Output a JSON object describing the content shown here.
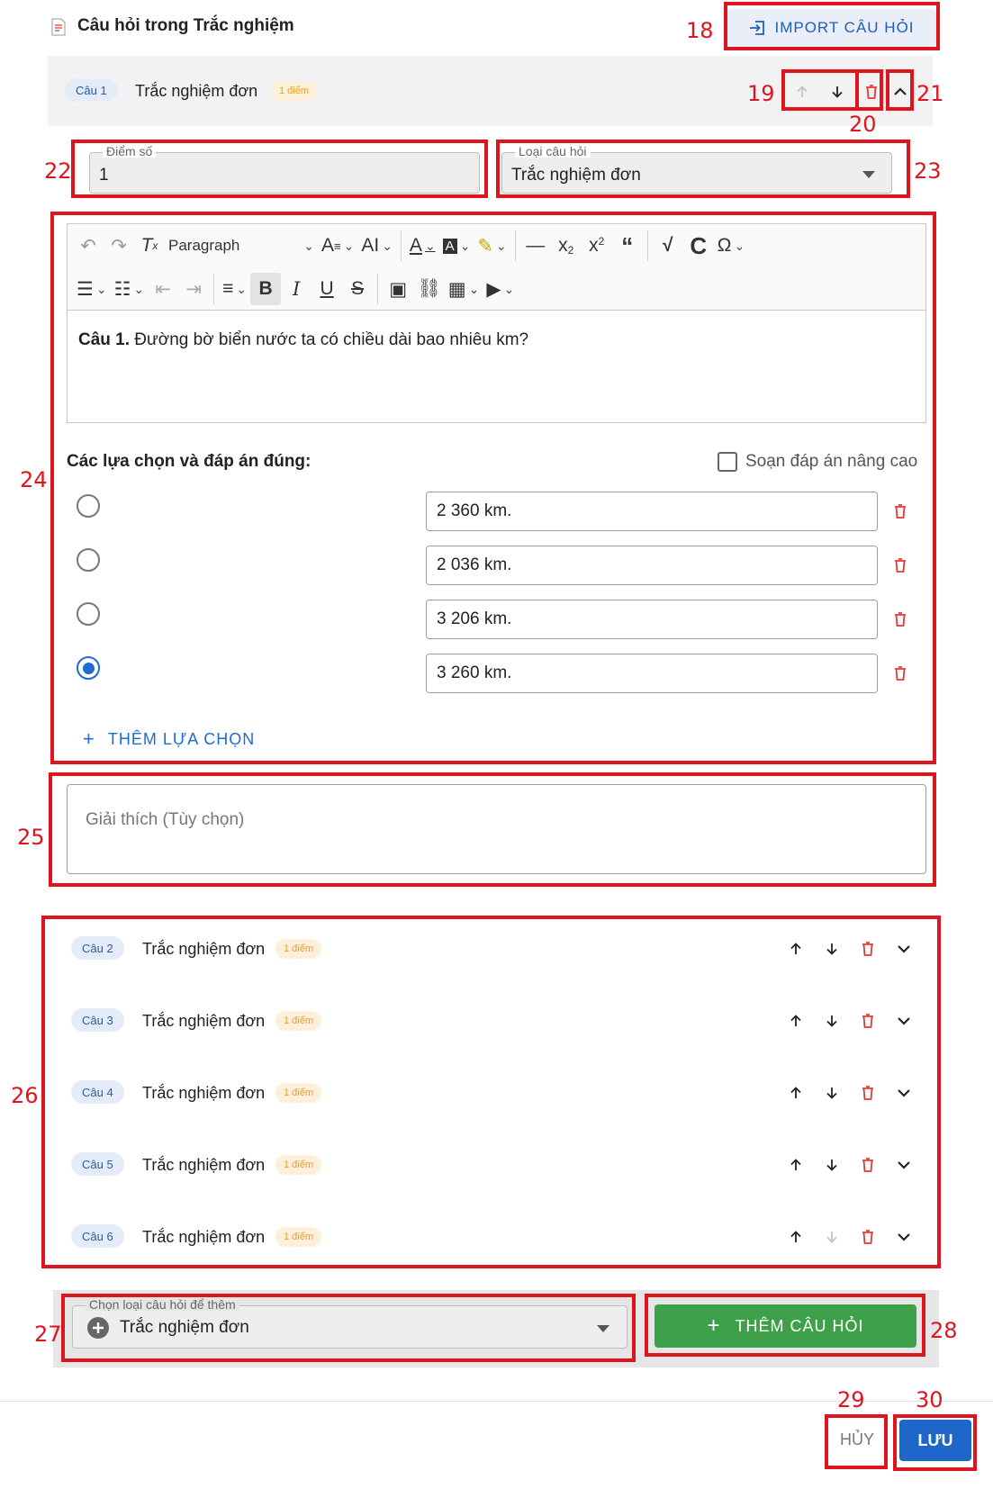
{
  "header": {
    "title": "Câu hỏi trong Trắc nghiệm",
    "import_label": "IMPORT CÂU HỎI"
  },
  "question1": {
    "chip": "Câu 1",
    "type": "Trắc nghiệm đơn",
    "points_badge": "1 điểm",
    "score_label": "Điểm số",
    "score_value": "1",
    "type_label": "Loại câu hỏi",
    "type_value": "Trắc nghiệm đơn",
    "editor": {
      "paragraph_label": "Paragraph",
      "content_bold": "Câu 1.",
      "content_text": " Đường bờ biển nước ta có chiều dài bao nhiêu km?"
    },
    "options_title": "Các lựa chọn và đáp án đúng:",
    "advanced_label": "Soạn đáp án nâng cao",
    "options": [
      {
        "text": "2 360 km.",
        "correct": false
      },
      {
        "text": "2 036 km.",
        "correct": false
      },
      {
        "text": "3 206 km.",
        "correct": false
      },
      {
        "text": "3 260 km.",
        "correct": true
      }
    ],
    "add_option_label": "THÊM LỰA CHỌN",
    "explanation_placeholder": "Giải thích (Tùy chọn)"
  },
  "questions": [
    {
      "chip": "Câu 2",
      "type": "Trắc nghiệm đơn",
      "points_badge": "1 điểm"
    },
    {
      "chip": "Câu 3",
      "type": "Trắc nghiệm đơn",
      "points_badge": "1 điểm"
    },
    {
      "chip": "Câu 4",
      "type": "Trắc nghiệm đơn",
      "points_badge": "1 điểm"
    },
    {
      "chip": "Câu 5",
      "type": "Trắc nghiệm đơn",
      "points_badge": "1 điểm"
    },
    {
      "chip": "Câu 6",
      "type": "Trắc nghiệm đơn",
      "points_badge": "1 điểm"
    }
  ],
  "add_section": {
    "select_label": "Chọn loại câu hỏi để thêm",
    "select_value": "Trắc nghiệm đơn",
    "add_button_label": "THÊM CÂU HỎI"
  },
  "footer": {
    "cancel_label": "HỦY",
    "save_label": "LƯU"
  },
  "annotations": [
    "18",
    "19",
    "20",
    "21",
    "22",
    "23",
    "24",
    "25",
    "26",
    "27",
    "28",
    "29",
    "30"
  ],
  "colors": {
    "annotation_red": "#e0141e",
    "primary_blue": "#1e66c9",
    "add_green": "#3fa04a",
    "delete_red": "#e53935",
    "badge_orange": "#f0a020"
  }
}
